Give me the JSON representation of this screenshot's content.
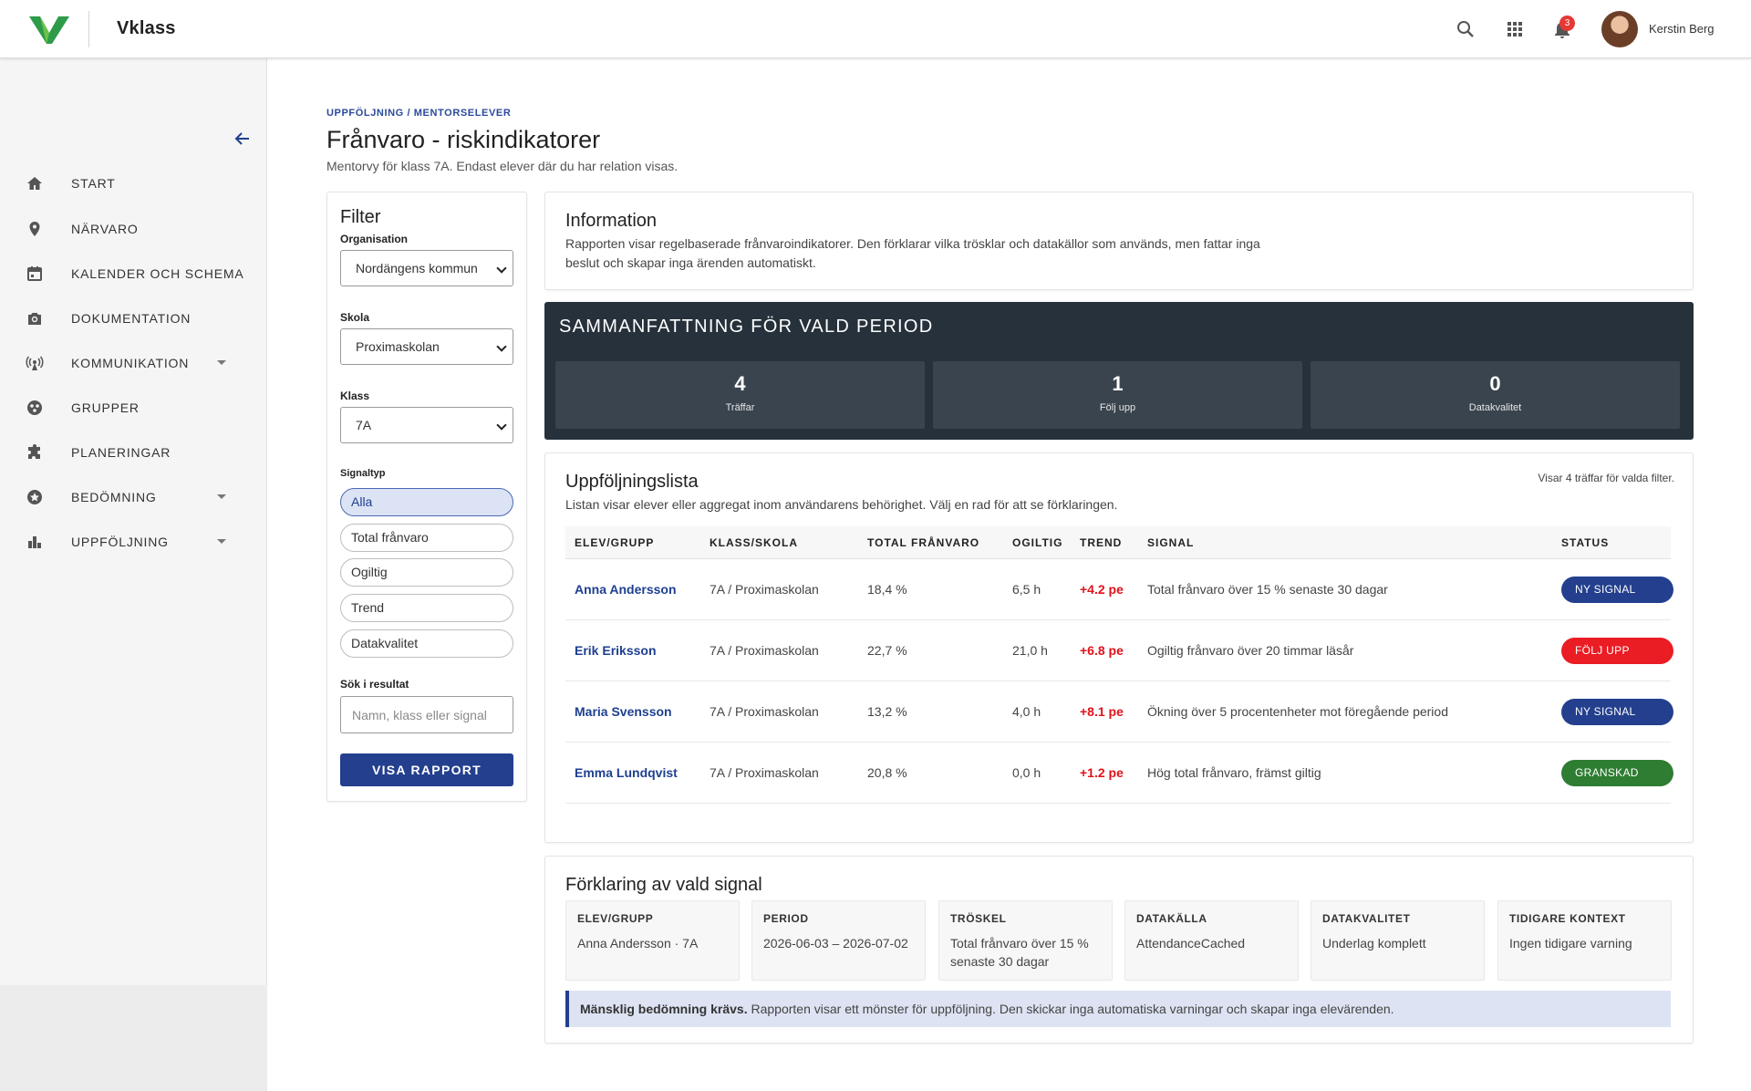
{
  "app": {
    "brand": "Vklass",
    "user_name": "Kerstin Berg",
    "notification_count": "3"
  },
  "sidebar": {
    "items": [
      {
        "label": "START",
        "icon": "home-icon",
        "has_caret": false
      },
      {
        "label": "NÄRVARO",
        "icon": "location-pin-icon",
        "has_caret": false
      },
      {
        "label": "KALENDER OCH SCHEMA",
        "icon": "calendar-icon",
        "has_caret": false
      },
      {
        "label": "DOKUMENTATION",
        "icon": "camera-icon",
        "has_caret": false
      },
      {
        "label": "KOMMUNIKATION",
        "icon": "broadcast-icon",
        "has_caret": true
      },
      {
        "label": "GRUPPER",
        "icon": "group-icon",
        "has_caret": false
      },
      {
        "label": "PLANERINGAR",
        "icon": "puzzle-icon",
        "has_caret": false
      },
      {
        "label": "BEDÖMNING",
        "icon": "star-badge-icon",
        "has_caret": true
      },
      {
        "label": "UPPFÖLJNING",
        "icon": "bar-chart-icon",
        "has_caret": true
      }
    ]
  },
  "page": {
    "breadcrumb": "UPPFÖLJNING / MENTORSELEVER",
    "title": "Frånvaro - riskindikatorer",
    "subtitle": "Mentorvy för klass 7A. Endast elever där du har relation visas."
  },
  "filter": {
    "title": "Filter",
    "org_label": "Organisation",
    "org_value": "Nordängens kommun",
    "school_label": "Skola",
    "school_value": "Proximaskolan",
    "class_label": "Klass",
    "class_value": "7A",
    "signal_label": "Signaltyp",
    "chips": [
      "Alla",
      "Total frånvaro",
      "Ogiltig",
      "Trend",
      "Datakvalitet"
    ],
    "active_chip": "Alla",
    "search_label": "Sök i resultat",
    "search_placeholder": "Namn, klass eller signal",
    "submit_label": "VISA RAPPORT"
  },
  "info": {
    "title": "Information",
    "text_line1": "Rapporten visar regelbaserade frånvaroindikatorer. Den förklarar vilka trösklar och datakällor som används, men fattar inga",
    "text_line2": "beslut och skapar inga ärenden automatiskt."
  },
  "summary": {
    "title": "SAMMANFATTNING FÖR VALD PERIOD",
    "stats": [
      {
        "value": "4",
        "label": "Träffar"
      },
      {
        "value": "1",
        "label": "Följ upp"
      },
      {
        "value": "0",
        "label": "Datakvalitet"
      }
    ]
  },
  "followup": {
    "title": "Uppföljningslista",
    "description": "Listan visar elever eller aggregat inom användarens behörighet. Välj en rad för att se förklaringen.",
    "count_text": "Visar 4 träffar för valda filter.",
    "headers": [
      "ELEV/GRUPP",
      "KLASS/SKOLA",
      "TOTAL FRÅNVARO",
      "OGILTIG",
      "TREND",
      "SIGNAL",
      "STATUS"
    ],
    "rows": [
      {
        "name": "Anna Andersson",
        "class": "7A / Proximaskolan",
        "total": "18,4 %",
        "invalid": "6,5 h",
        "trend": "+4.2 pe",
        "signal": "Total frånvaro över 15 % senaste 30 dagar",
        "status": "NY SIGNAL",
        "status_color": "#233f8e"
      },
      {
        "name": "Erik Eriksson",
        "class": "7A / Proximaskolan",
        "total": "22,7 %",
        "invalid": "21,0 h",
        "trend": "+6.8 pe",
        "signal": "Ogiltig frånvaro över 20 timmar läsår",
        "status": "FÖLJ UPP",
        "status_color": "#ea1c24"
      },
      {
        "name": "Maria Svensson",
        "class": "7A / Proximaskolan",
        "total": "13,2 %",
        "invalid": "4,0 h",
        "trend": "+8.1 pe",
        "signal": "Ökning över 5 procentenheter mot föregående period",
        "status": "NY SIGNAL",
        "status_color": "#233f8e"
      },
      {
        "name": "Emma Lundqvist",
        "class": "7A / Proximaskolan",
        "total": "20,8 %",
        "invalid": "0,0 h",
        "trend": "+1.2 pe",
        "signal": "Hög total frånvaro, främst giltig",
        "status": "GRANSKAD",
        "status_color": "#2e7d32"
      }
    ]
  },
  "explanation": {
    "title": "Förklaring av vald signal",
    "boxes": [
      {
        "label": "ELEV/GRUPP",
        "value": "Anna Andersson · 7A"
      },
      {
        "label": "PERIOD",
        "value": "2026-06-03 – 2026-07-02"
      },
      {
        "label": "TRÖSKEL",
        "value": "Total frånvaro över 15 % senaste 30 dagar"
      },
      {
        "label": "DATAKÄLLA",
        "value": "AttendanceCached"
      },
      {
        "label": "DATAKVALITET",
        "value": "Underlag komplett"
      },
      {
        "label": "TIDIGARE KONTEXT",
        "value": "Ingen tidigare varning"
      }
    ],
    "note_bold": "Mänsklig bedömning krävs.",
    "note_text": " Rapporten visar ett mönster för uppföljning. Den skickar inga automatiska varningar och skapar inga elevärenden."
  },
  "colors": {
    "primary": "#233f8e",
    "summary_bg": "#26313b",
    "danger": "#ea1c24",
    "success": "#2e7d32",
    "logo_green": "#2e9b4a"
  }
}
